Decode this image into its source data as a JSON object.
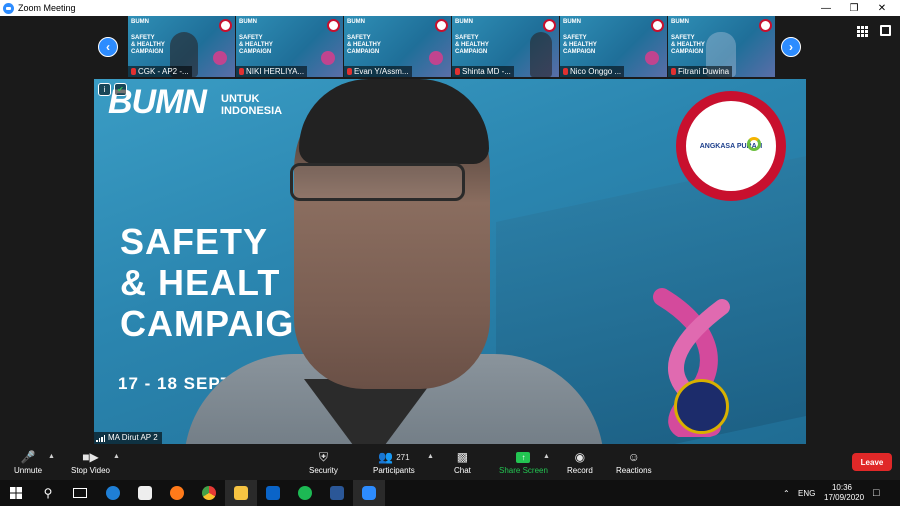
{
  "window": {
    "title": "Zoom Meeting"
  },
  "thumbnails": [
    {
      "name": "CGK - AP2 -...",
      "slide_logo": "BUMN",
      "slide_title": "SAFETY\n& HEALTHY\nCAMPAIGN"
    },
    {
      "name": "NIKI HERLIYA...",
      "slide_logo": "BUMN",
      "slide_title": "SAFETY\n& HEALTHY\nCAMPAIGN"
    },
    {
      "name": "Evan Y/Assm...",
      "slide_logo": "BUMN",
      "slide_title": "SAFETY\n& HEALTHY\nCAMPAIGN"
    },
    {
      "name": "Shinta MD -...",
      "slide_logo": "BUMN",
      "slide_title": "SAFETY\n& HEALTHY\nCAMPAIGN"
    },
    {
      "name": "Nico Onggo ...",
      "slide_logo": "BUMN",
      "slide_title": "SAFETY\n& HEALTHY\nCAMPAIGN"
    },
    {
      "name": "Fitrani Duwina",
      "slide_logo": "BUMN",
      "slide_title": "SAFETY\n& HEALTHY\nCAMPAIGN"
    }
  ],
  "main_video": {
    "logo": "BUMN",
    "logo_sub_1": "UNTUK",
    "logo_sub_2": "INDONESIA",
    "headline_1": "SAFETY",
    "headline_2": "& HEALT",
    "headline_3": "CAMPAIG",
    "dates": "17 - 18 SEPTEM",
    "partner_logo": "ANGKASA PURA II",
    "speaker_name": "MA Dirut AP 2"
  },
  "toolbar": {
    "unmute": "Unmute",
    "stop_video": "Stop Video",
    "security": "Security",
    "participants": "Participants",
    "participants_count": "271",
    "chat": "Chat",
    "share_screen": "Share Screen",
    "record": "Record",
    "reactions": "Reactions",
    "leave": "Leave"
  },
  "taskbar": {
    "language": "ENG",
    "time": "10:36",
    "date": "17/09/2020"
  },
  "colors": {
    "zoom_blue": "#2d8cff",
    "leave_red": "#e02828",
    "share_green": "#23c552",
    "slide_blue": "#2b86b0",
    "brand_red": "#c8102e"
  }
}
